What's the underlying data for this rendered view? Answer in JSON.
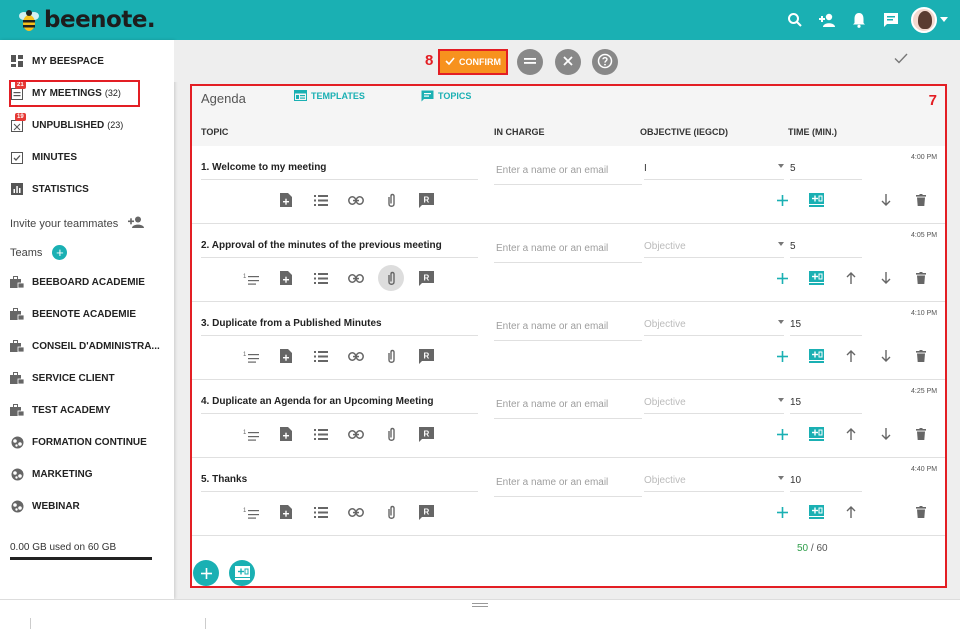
{
  "app": {
    "logo_text": "beenote."
  },
  "sidebar": {
    "items": [
      {
        "label": "MY BEESPACE",
        "count": "",
        "badge": "",
        "icon": "grid-icon"
      },
      {
        "label": "MY MEETINGS",
        "count": "(32)",
        "badge": "21",
        "icon": "meeting-icon"
      },
      {
        "label": "UNPUBLISHED",
        "count": "(23)",
        "badge": "19",
        "icon": "unpublished-icon"
      },
      {
        "label": "MINUTES",
        "count": "",
        "badge": "",
        "icon": "minutes-icon"
      },
      {
        "label": "STATISTICS",
        "count": "",
        "badge": "",
        "icon": "bar-chart-icon"
      }
    ],
    "invite_label": "Invite your teammates",
    "teams_label": "Teams",
    "teams": [
      {
        "label": "BEEBOARD ACADEMIE",
        "icon": "lock-briefcase-icon"
      },
      {
        "label": "BEENOTE ACADEMIE",
        "icon": "lock-briefcase-icon"
      },
      {
        "label": "CONSEIL D'ADMINISTRA...",
        "icon": "lock-briefcase-icon"
      },
      {
        "label": "SERVICE CLIENT",
        "icon": "lock-briefcase-icon"
      },
      {
        "label": "TEST ACADEMY",
        "icon": "lock-briefcase-icon"
      },
      {
        "label": "FORMATION CONTINUE",
        "icon": "globe-icon"
      },
      {
        "label": "MARKETING",
        "icon": "globe-icon"
      },
      {
        "label": "WEBINAR",
        "icon": "globe-icon"
      }
    ],
    "storage": "0.00 GB used on 60 GB"
  },
  "actionbar": {
    "confirm_number": "8",
    "confirm_label": "CONFIRM"
  },
  "agenda": {
    "panel_number": "7",
    "title": "Agenda",
    "tab_templates": "TEMPLATES",
    "tab_topics": "TOPICS",
    "columns": {
      "topic": "TOPIC",
      "in_charge": "IN CHARGE",
      "objective": "OBJECTIVE (IEGCD)",
      "time": "TIME (MIN.)"
    },
    "rows": [
      {
        "title": "1. Welcome to my meeting",
        "in_charge": "Enter a name or an email",
        "objective": "I",
        "time": "5",
        "clock": "4:00 PM"
      },
      {
        "title": "2. Approval of the minutes of the previous meeting",
        "in_charge": "Enter a name or an email",
        "objective": "Objective",
        "time": "5",
        "clock": "4:05 PM"
      },
      {
        "title": "3. Duplicate from a Published Minutes",
        "in_charge": "Enter a name or an email",
        "objective": "Objective",
        "time": "15",
        "clock": "4:10 PM"
      },
      {
        "title": "4. Duplicate an Agenda for an Upcoming Meeting",
        "in_charge": "Enter a name or an email",
        "objective": "Objective",
        "time": "15",
        "clock": "4:25 PM"
      },
      {
        "title": "5. Thanks",
        "in_charge": "Enter a name or an email",
        "objective": "Objective",
        "time": "10",
        "clock": "4:40 PM"
      }
    ],
    "total_used": "50",
    "total_sep": " / ",
    "total_max": "60"
  }
}
